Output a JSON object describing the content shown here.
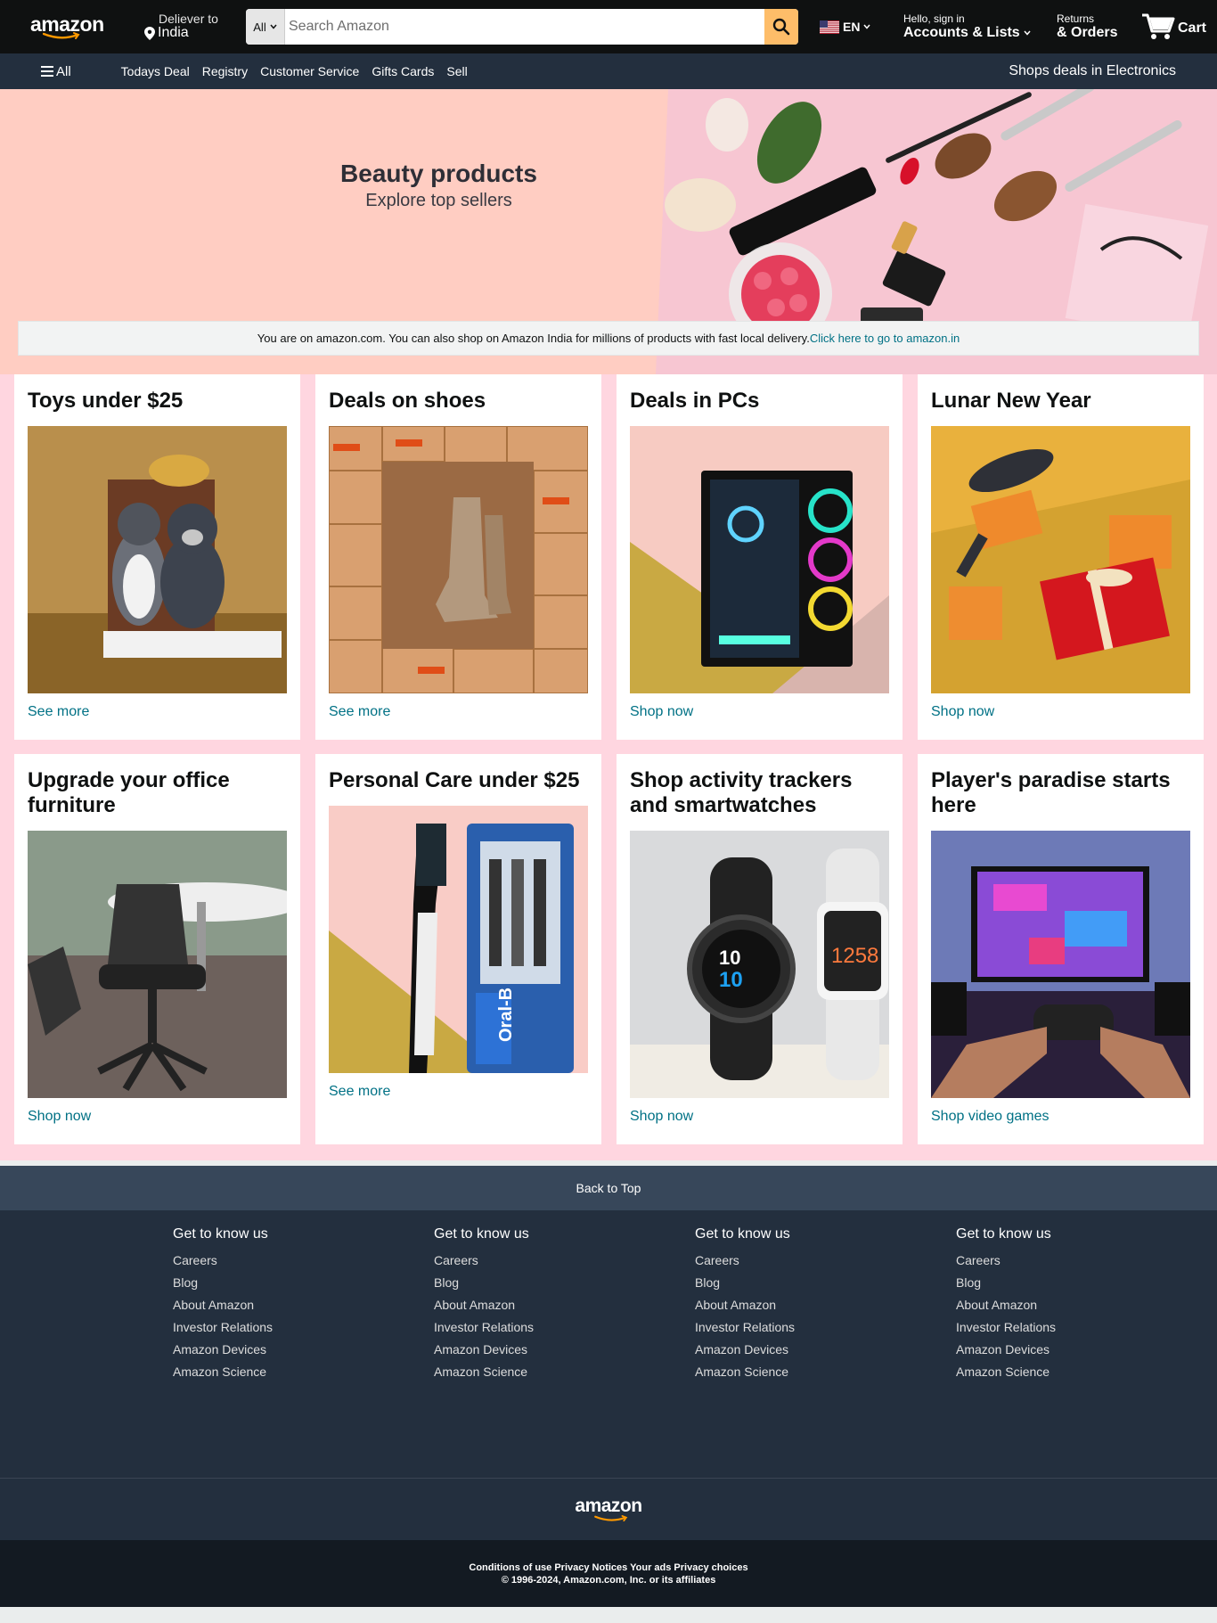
{
  "nav": {
    "logo": "amazon",
    "deliver_line1": "Deliever to",
    "deliver_line2": "India",
    "search_category": "All",
    "search_placeholder": "Search Amazon",
    "language": "EN",
    "account_line1": "Hello, sign in",
    "account_line2": "Accounts & Lists",
    "returns_line1": "Returns",
    "returns_line2": "& Orders",
    "cart_label": "Cart"
  },
  "subnav": {
    "all_label": "All",
    "links": [
      "Todays Deal",
      "Registry",
      "Customer Service",
      "Gifts Cards",
      "Sell"
    ],
    "right_label": "Shops deals in Electronics"
  },
  "hero": {
    "title": "Beauty products",
    "subtitle": "Explore top sellers",
    "notice_text": "You are on amazon.com. You can also shop on Amazon India for millions of products with fast local delivery.",
    "notice_link": "Click here to go to amazon.in"
  },
  "cards": [
    {
      "title": "Toys under $25",
      "link": "See more",
      "image": "teddy-bears-in-box"
    },
    {
      "title": "Deals on shoes",
      "link": "See more",
      "image": "boots-in-boxes"
    },
    {
      "title": "Deals in PCs",
      "link": "Shop now",
      "image": "gaming-pc"
    },
    {
      "title": "Lunar New Year",
      "link": "Shop now",
      "image": "gift-boxes"
    },
    {
      "title": "Upgrade your office furniture",
      "link": "Shop now",
      "image": "office-chair"
    },
    {
      "title": "Personal Care under $25",
      "link": "See more",
      "image": "toothbrushes"
    },
    {
      "title": "Shop activity trackers and smartwatches",
      "link": "Shop now",
      "image": "smartwatches"
    },
    {
      "title": "Player's paradise starts here",
      "link": "Shop video games",
      "image": "gaming-setup"
    }
  ],
  "footer": {
    "back_to_top": "Back to Top",
    "columns": [
      {
        "title": "Get to know us",
        "items": [
          "Careers",
          "Blog",
          "About Amazon",
          "Investor Relations",
          "Amazon Devices",
          "Amazon Science"
        ]
      },
      {
        "title": "Get to know us",
        "items": [
          "Careers",
          "Blog",
          "About Amazon",
          "Investor Relations",
          "Amazon Devices",
          "Amazon Science"
        ]
      },
      {
        "title": "Get to know us",
        "items": [
          "Careers",
          "Blog",
          "About Amazon",
          "Investor Relations",
          "Amazon Devices",
          "Amazon Science"
        ]
      },
      {
        "title": "Get to know us",
        "items": [
          "Careers",
          "Blog",
          "About Amazon",
          "Investor Relations",
          "Amazon Devices",
          "Amazon Science"
        ]
      }
    ],
    "logo": "amazon",
    "legal_line1": "Conditions of use Privacy Notices Your ads Privacy choices",
    "legal_line2": "© 1996-2024, Amazon.com, Inc. or its affiliates"
  },
  "colors": {
    "nav_bg": "#0f1111",
    "subnav_bg": "#232f3e",
    "accent": "#febd69",
    "link": "#007185",
    "page_bg": "#ffd6e0"
  }
}
